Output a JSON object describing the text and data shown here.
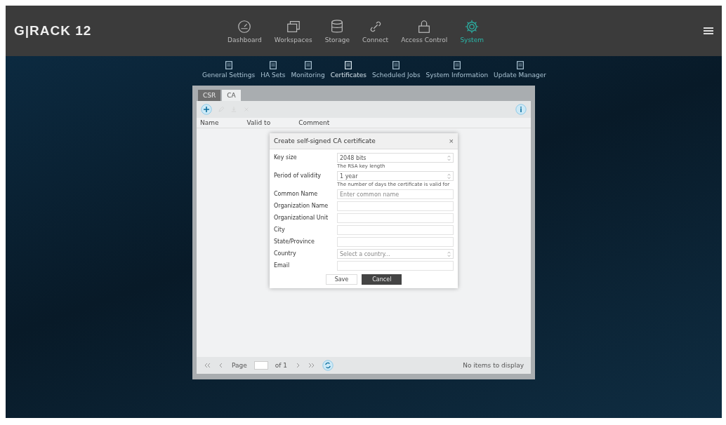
{
  "brand": {
    "name": "G|RACK",
    "version": "12"
  },
  "main_nav": [
    {
      "label": "Dashboard",
      "selected": false
    },
    {
      "label": "Workspaces",
      "selected": false
    },
    {
      "label": "Storage",
      "selected": false
    },
    {
      "label": "Connect",
      "selected": false
    },
    {
      "label": "Access Control",
      "selected": false
    },
    {
      "label": "System",
      "selected": true
    }
  ],
  "sub_nav": [
    {
      "label": "General Settings",
      "selected": false
    },
    {
      "label": "HA Sets",
      "selected": false
    },
    {
      "label": "Monitoring",
      "selected": false
    },
    {
      "label": "Certificates",
      "selected": true
    },
    {
      "label": "Scheduled Jobs",
      "selected": false
    },
    {
      "label": "System Information",
      "selected": false
    },
    {
      "label": "Update Manager",
      "selected": false
    }
  ],
  "panel": {
    "tabs": [
      {
        "label": "CSR",
        "selected": false
      },
      {
        "label": "CA",
        "selected": true
      }
    ],
    "columns": [
      "Name",
      "Valid to",
      "Comment"
    ],
    "pager": {
      "page_label": "Page",
      "of_label": "of 1",
      "status": "No items to display"
    }
  },
  "dialog": {
    "title": "Create self-signed CA certificate",
    "close": "×",
    "fields": [
      {
        "label": "Key size",
        "kind": "select",
        "value": "2048 bits",
        "hint": "The RSA key length"
      },
      {
        "label": "Period of validity",
        "kind": "select",
        "value": "1 year",
        "hint": "The number of days the certificate is valid for"
      },
      {
        "label": "Common Name",
        "kind": "text",
        "placeholder": "Enter common name"
      },
      {
        "label": "Organization Name",
        "kind": "text"
      },
      {
        "label": "Organizational Unit",
        "kind": "text"
      },
      {
        "label": "City",
        "kind": "text"
      },
      {
        "label": "State/Province",
        "kind": "text"
      },
      {
        "label": "Country",
        "kind": "select",
        "placeholder": "Select a country..."
      },
      {
        "label": "Email",
        "kind": "text"
      }
    ],
    "buttons": [
      {
        "label": "Save",
        "kind": "secondary"
      },
      {
        "label": "Cancel",
        "kind": "primary"
      }
    ]
  }
}
